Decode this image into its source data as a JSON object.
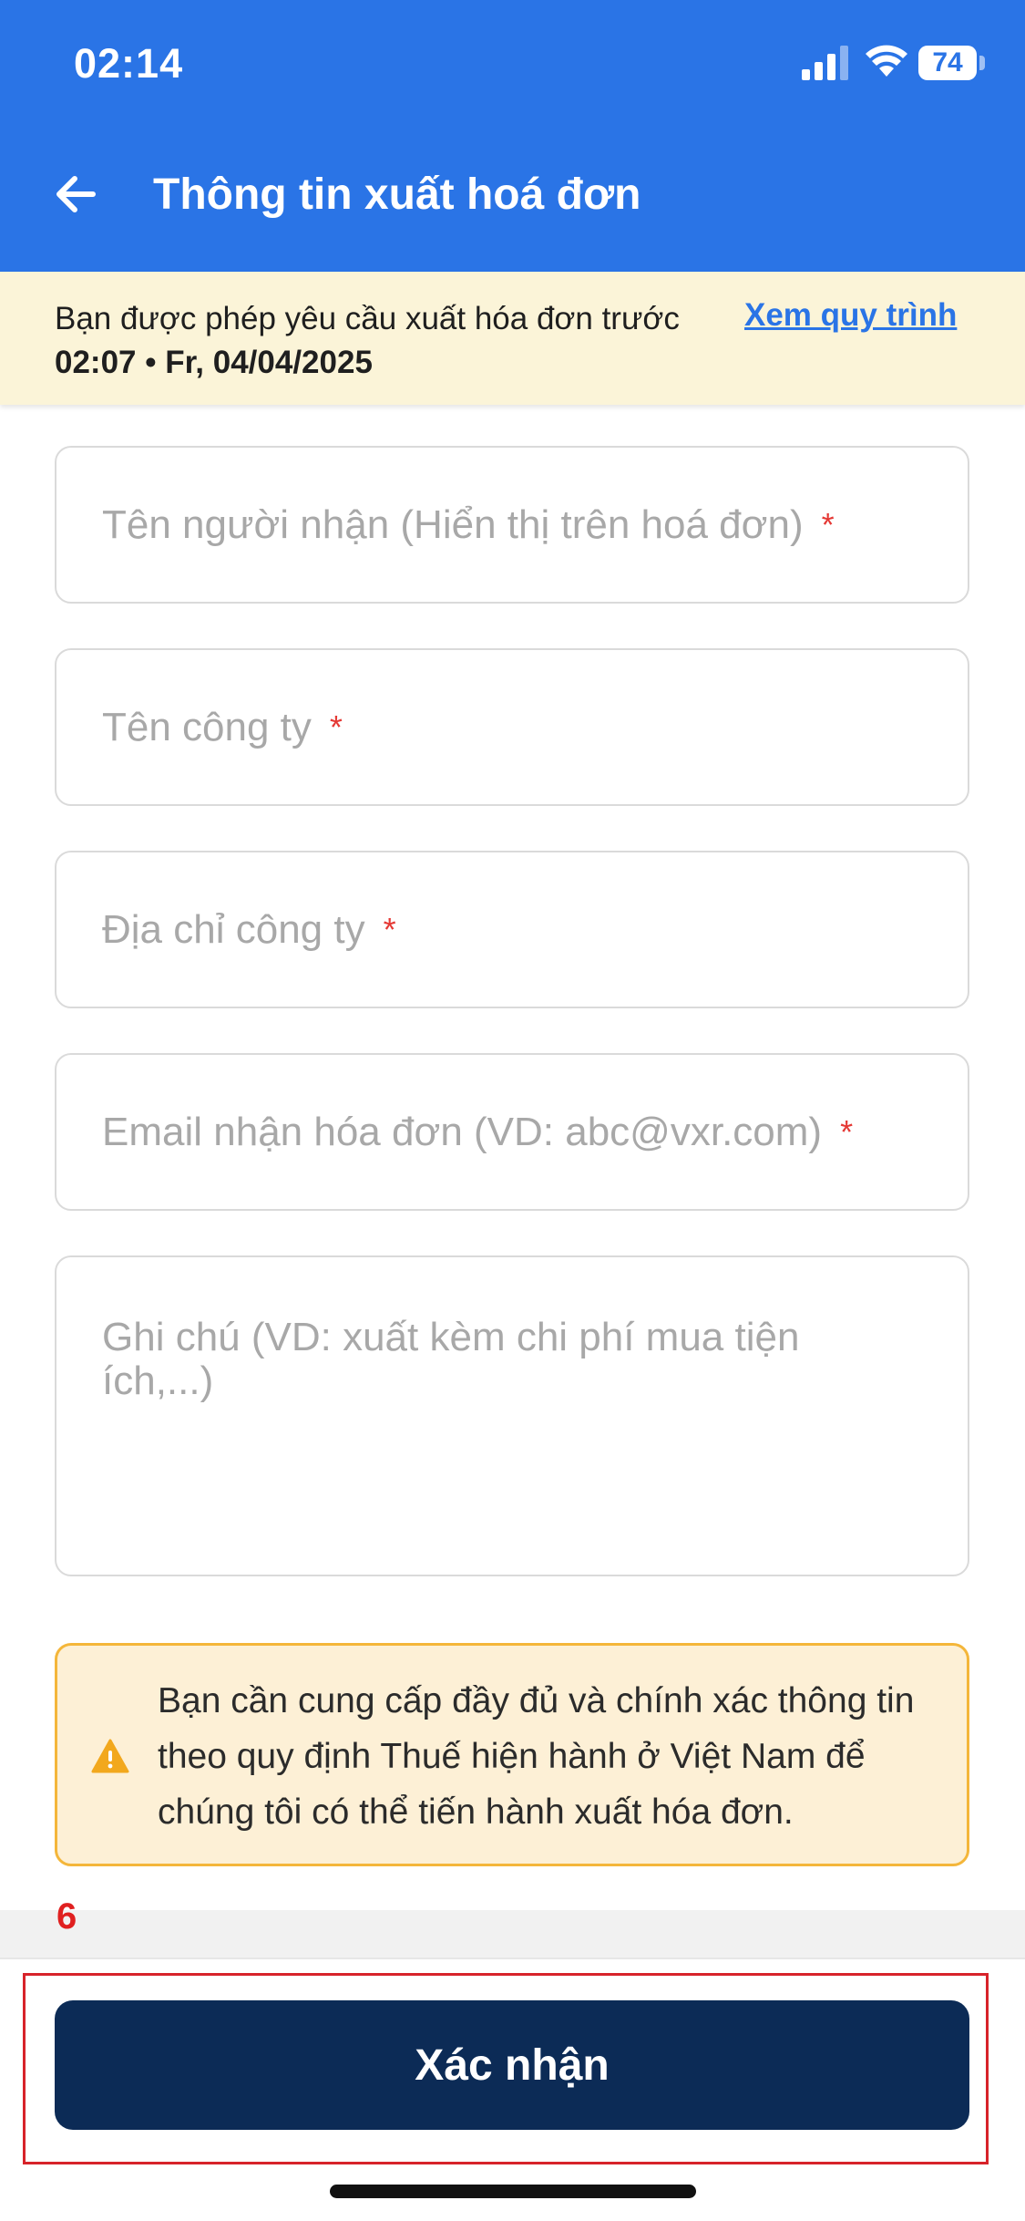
{
  "status_bar": {
    "time": "02:14",
    "battery": "74"
  },
  "header": {
    "title": "Thông tin xuất hoá đơn",
    "back_icon": "arrow-left-icon",
    "color": "#2a74e6"
  },
  "banner": {
    "text_prefix": "Bạn được phép yêu cầu xuất hóa đơn trước ",
    "deadline": "02:07 • Fr, 04/04/2025",
    "link_label": "Xem quy trình"
  },
  "form": {
    "recipient_name": {
      "placeholder": "Tên người nhận (Hiển thị trên hoá đơn)",
      "required_mark": "*"
    },
    "company_name": {
      "placeholder": "Tên công ty",
      "required_mark": "*"
    },
    "company_address": {
      "placeholder": "Địa chỉ công ty",
      "required_mark": "*"
    },
    "email": {
      "placeholder": "Email nhận hóa đơn (VD: abc@vxr.com)",
      "required_mark": "*"
    },
    "note": {
      "placeholder": "Ghi chú (VD: xuất kèm chi phí mua tiện ích,...)"
    }
  },
  "warning": {
    "icon": "warning-triangle-icon",
    "text": "Bạn cần cung cấp đầy đủ và chính xác thông tin theo quy định Thuế hiện hành ở Việt Nam để chúng tôi có thể tiến hành xuất hóa đơn."
  },
  "annotation": {
    "step": "6"
  },
  "footer": {
    "confirm_label": "Xác nhận",
    "button_color": "#0c2b56"
  }
}
